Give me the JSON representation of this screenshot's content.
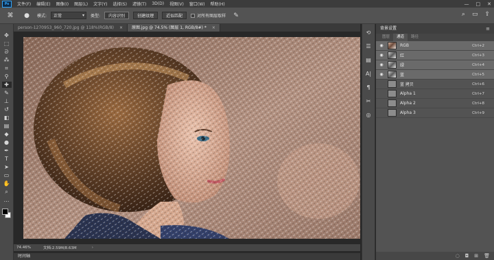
{
  "app": {
    "logo": "Ps",
    "menu": [
      "文件(F)",
      "编辑(E)",
      "图像(I)",
      "图层(L)",
      "文字(Y)",
      "选择(S)",
      "滤镜(T)",
      "3D(D)",
      "视图(V)",
      "窗口(W)",
      "帮助(H)"
    ],
    "window_controls": [
      "—",
      "□",
      "✕"
    ]
  },
  "options": {
    "mode_label": "模式:",
    "mode_value": "正常",
    "type_label": "类型:",
    "type_buttons": [
      "内容识别",
      "创建纹理",
      "近似匹配"
    ],
    "sample_all_layers": "对所有图层取样"
  },
  "tabs": [
    {
      "label": "person-1270953_960_720.jpg @ 118%(RGB/8)"
    },
    {
      "label": "原图.jpg @ 74.5% (图层 1, RGB/8#) *"
    }
  ],
  "status": {
    "zoom": "74.46%",
    "doc": "文档:2.59M/8.63M"
  },
  "timeline_label": "时间轴",
  "panel": {
    "title": "背景设置",
    "tabs": [
      "图层",
      "通道",
      "路径"
    ],
    "channels": [
      {
        "name": "RGB",
        "shortcut": "Ctrl+2",
        "visible": true,
        "thumb": "color"
      },
      {
        "name": "红",
        "shortcut": "Ctrl+3",
        "visible": true,
        "thumb": "gray"
      },
      {
        "name": "绿",
        "shortcut": "Ctrl+4",
        "visible": true,
        "thumb": "gray"
      },
      {
        "name": "蓝",
        "shortcut": "Ctrl+5",
        "visible": true,
        "thumb": "gray"
      },
      {
        "name": "蓝 拷贝",
        "shortcut": "Ctrl+6",
        "visible": false,
        "thumb": "plain"
      },
      {
        "name": "Alpha 1",
        "shortcut": "Ctrl+7",
        "visible": false,
        "thumb": "plain"
      },
      {
        "name": "Alpha 2",
        "shortcut": "Ctrl+8",
        "visible": false,
        "thumb": "plain"
      },
      {
        "name": "Alpha 3",
        "shortcut": "Ctrl+9",
        "visible": false,
        "thumb": "plain"
      }
    ]
  }
}
